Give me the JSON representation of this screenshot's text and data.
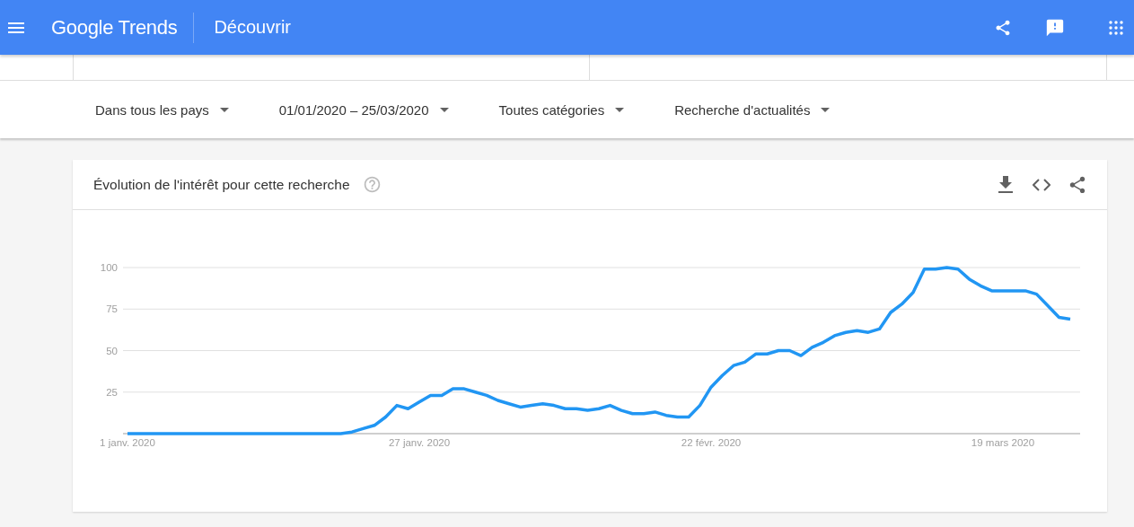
{
  "header": {
    "logo": "Google Trends",
    "title": "Découvrir"
  },
  "filters": [
    {
      "label": "Dans tous les pays"
    },
    {
      "label": "01/01/2020 – 25/03/2020"
    },
    {
      "label": "Toutes catégories"
    },
    {
      "label": "Recherche d'actualités"
    }
  ],
  "card": {
    "title": "Évolution de l'intérêt pour cette recherche",
    "chart_data": {
      "type": "line",
      "grid": true,
      "ylim": [
        0,
        100
      ],
      "yticks": [
        25,
        50,
        75,
        100
      ],
      "categories": [
        "1 janv. 2020",
        null,
        null,
        null,
        null,
        null,
        null,
        null,
        null,
        null,
        null,
        null,
        null,
        null,
        null,
        null,
        null,
        null,
        null,
        null,
        null,
        null,
        null,
        null,
        null,
        null,
        "27 janv. 2020",
        null,
        null,
        null,
        null,
        null,
        null,
        null,
        null,
        null,
        null,
        null,
        null,
        null,
        null,
        null,
        null,
        null,
        null,
        null,
        null,
        null,
        null,
        null,
        null,
        null,
        "22 févr. 2020",
        null,
        null,
        null,
        null,
        null,
        null,
        null,
        null,
        null,
        null,
        null,
        null,
        null,
        null,
        null,
        null,
        null,
        null,
        null,
        null,
        null,
        null,
        null,
        null,
        null,
        "19 mars 2020",
        null,
        null,
        null,
        null,
        null,
        null
      ],
      "series": [
        {
          "color": "#2196f3",
          "values": [
            0,
            0,
            0,
            0,
            0,
            0,
            0,
            0,
            0,
            0,
            0,
            0,
            0,
            0,
            0,
            0,
            0,
            0,
            0,
            0,
            1,
            3,
            5,
            10,
            17,
            15,
            19,
            23,
            23,
            27,
            27,
            25,
            23,
            20,
            18,
            16,
            17,
            18,
            17,
            15,
            15,
            14,
            15,
            17,
            14,
            12,
            12,
            13,
            11,
            10,
            10,
            17,
            28,
            35,
            41,
            43,
            48,
            48,
            50,
            50,
            47,
            52,
            55,
            59,
            61,
            62,
            61,
            63,
            73,
            78,
            85,
            99,
            99,
            100,
            99,
            93,
            89,
            86,
            86,
            86,
            86,
            84,
            77,
            70,
            69
          ]
        }
      ]
    }
  }
}
